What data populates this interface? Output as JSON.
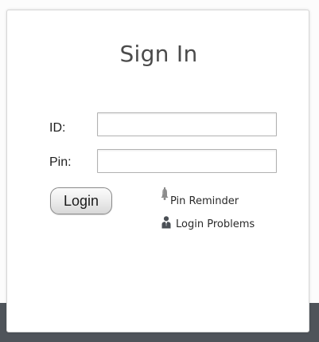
{
  "form": {
    "title": "Sign In",
    "id_label": "ID:",
    "id_value": "",
    "pin_label": "Pin:",
    "pin_value": "",
    "login_label": "Login"
  },
  "links": {
    "pin_reminder": "Pin Reminder",
    "login_problems": "Login Problems"
  },
  "icons": {
    "pin_reminder": "bell-icon",
    "login_problems": "user-support-icon"
  },
  "colors": {
    "page_background": "#fcfcfc",
    "card_background": "#ffffff",
    "card_border": "#d6d6d6",
    "bottom_band": "#4f545a",
    "title_text": "#4b4b4b"
  }
}
